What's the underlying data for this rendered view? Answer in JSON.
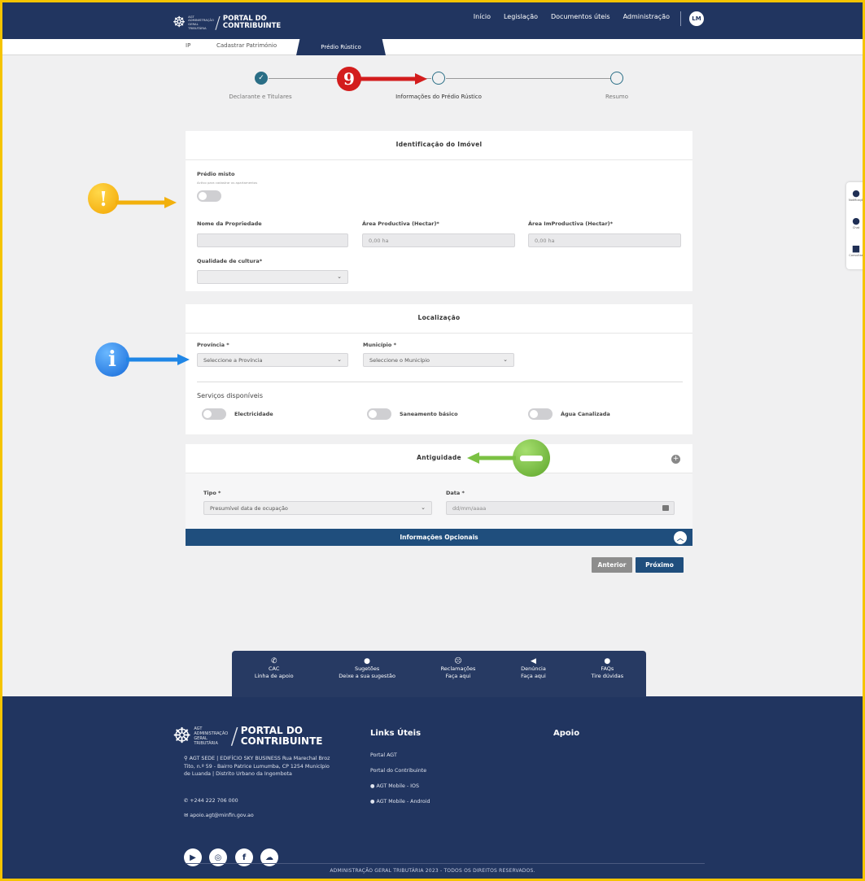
{
  "header": {
    "logo_small": "AGT ADMINISTRAÇÃO GERAL TRIBUTÁRIA",
    "logo_line1": "PORTAL DO",
    "logo_line2": "CONTRIBUINTE",
    "nav": [
      "Início",
      "Legislação",
      "Documentos úteis",
      "Administração"
    ],
    "avatar": "LM"
  },
  "subnav": {
    "tabs": [
      "IP",
      "Cadastrar Património"
    ],
    "active_tab": "Prédio Rústico"
  },
  "stepper": {
    "steps": [
      {
        "label": "Declarante e Titulares",
        "state": "done"
      },
      {
        "label": "Informações do Prédio Rústico",
        "state": "active"
      },
      {
        "label": "Resumo",
        "state": "pending"
      }
    ]
  },
  "identificacao": {
    "title": "Identificação do Imóvel",
    "predio_misto_label": "Prédio misto",
    "predio_misto_hint": "Activo para cadastrar os apartamentos",
    "nome_label": "Nome da Propriedade",
    "nome_value": "",
    "area_prod_label": "Área Productiva (Hectar)*",
    "area_prod_value": "0,00 ha",
    "area_improd_label": "Área ImProductiva (Hectar)*",
    "area_improd_value": "0,00 ha",
    "qualidade_label": "Qualidade de cultura*",
    "qualidade_value": ""
  },
  "localizacao": {
    "title": "Localização",
    "provincia_label": "Província *",
    "provincia_value": "Seleccione a Província",
    "municipio_label": "Município *",
    "municipio_value": "Seleccione o Município",
    "servicos_label": "Serviços disponíveis",
    "servicos": [
      "Electricidade",
      "Saneamento básico",
      "Água Canalizada"
    ]
  },
  "antiguidade": {
    "title": "Antiguidade",
    "tipo_label": "Tipo *",
    "tipo_value": "Presumível data de ocupação",
    "data_label": "Data *",
    "data_placeholder": "dd/mm/aaaa"
  },
  "optional_bar": "Informações Opcionais",
  "buttons": {
    "anterior": "Anterior",
    "proximo": "Próximo"
  },
  "side_widget": [
    {
      "icon": "bell-icon",
      "label": "Notificações"
    },
    {
      "icon": "chat-icon",
      "label": "Chat"
    },
    {
      "icon": "consult-icon",
      "label": "Consultas"
    }
  ],
  "cac": [
    {
      "title": "CAC",
      "sub": "Linha de apoio"
    },
    {
      "title": "Sugetões",
      "sub": "Deixe a sua sugestão"
    },
    {
      "title": "Reclamações",
      "sub": "Faça aqui"
    },
    {
      "title": "Denúncia",
      "sub": "Faça aqui"
    },
    {
      "title": "FAQs",
      "sub": "Tire dúvidas"
    }
  ],
  "footer": {
    "address": "AGT SEDE | EDIFÍCIO SKY BUSINESS Rua Marechal Broz Tito, n.º 59 - Bairro Patrice Lumumba, CP 1254 Município de Luanda | Distrito Urbano da Ingombota",
    "phone": "+244 222 706 000",
    "email": "apoio.agt@minfin.gov.ao",
    "links_title": "Links Úteis",
    "links": [
      "Portal AGT",
      "Portal do Contribuinte",
      "AGT Mobile - IOS",
      "AGT Mobile - Android"
    ],
    "apoio_title": "Apoio",
    "copyright": "ADMINISTRAÇÃO GERAL TRIBUTÁRIA 2023 - TODOS OS DIREITOS RESERVADOS."
  },
  "annotations": {
    "step_number": "9",
    "warning_symbol": "!",
    "info_symbol": "i"
  },
  "colors": {
    "navy": "#213560",
    "bar_blue": "#1f4e7d",
    "teal": "#2a6e86",
    "red_callout": "#d31d1d",
    "yellow_callout": "#f2b00c",
    "blue_callout": "#1f86e6",
    "green_callout": "#7bc143"
  }
}
